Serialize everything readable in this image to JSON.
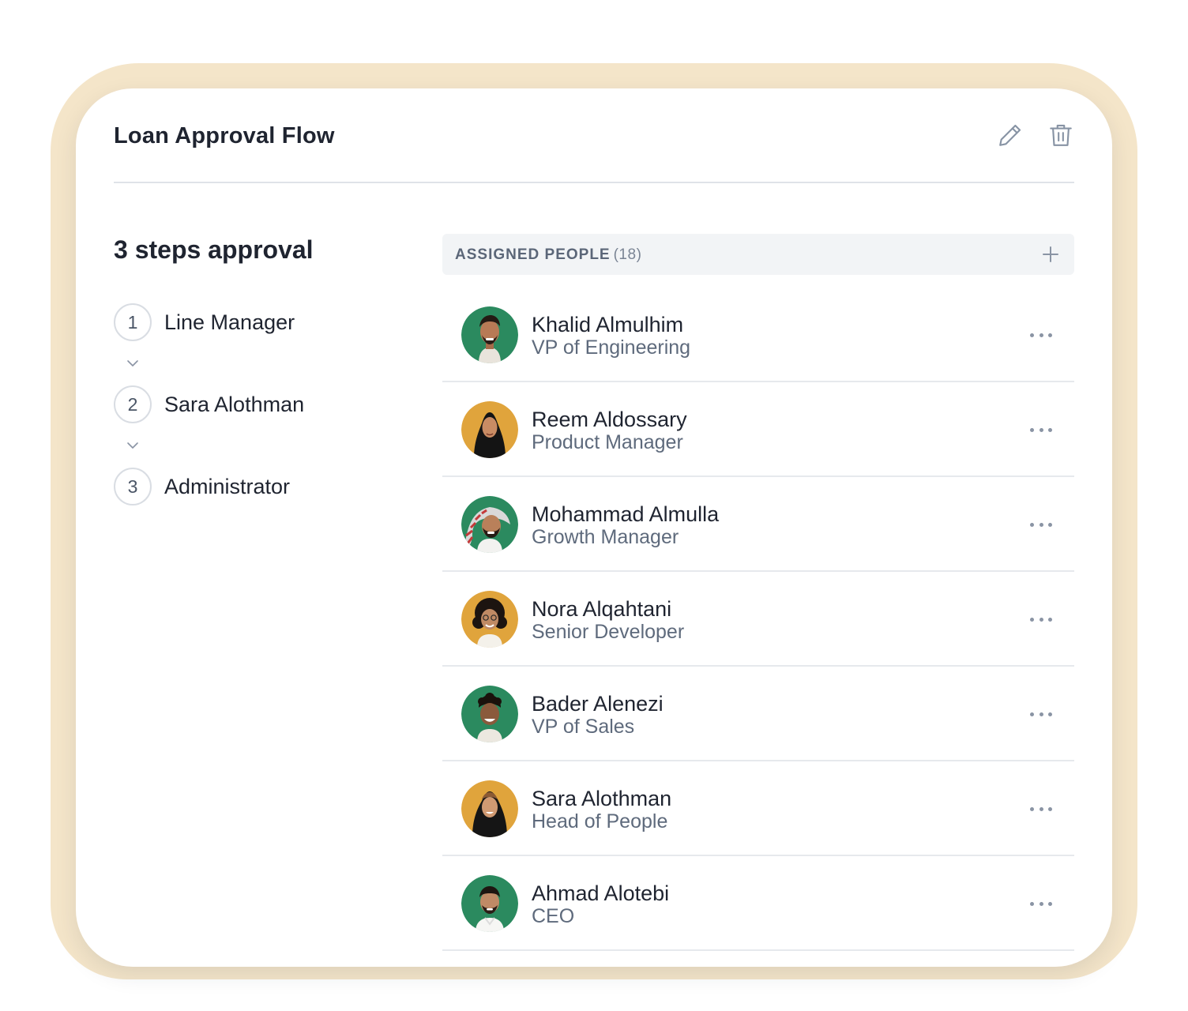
{
  "card": {
    "title": "Loan Approval Flow",
    "edit_icon": "pencil-icon",
    "delete_icon": "trash-icon"
  },
  "steps": {
    "title": "3 steps approval",
    "items": [
      {
        "number": "1",
        "label": "Line Manager"
      },
      {
        "number": "2",
        "label": "Sara Alothman"
      },
      {
        "number": "3",
        "label": "Administrator"
      }
    ]
  },
  "assigned": {
    "label": "ASSIGNED PEOPLE",
    "count": "(18)",
    "add_icon": "plus-icon"
  },
  "people": [
    {
      "name": "Khalid Almulhim",
      "role": "VP of Engineering",
      "avatar_bg": "#2b8a5f"
    },
    {
      "name": "Reem Aldossary",
      "role": "Product Manager",
      "avatar_bg": "#e0a43c"
    },
    {
      "name": "Mohammad Almulla",
      "role": "Growth Manager",
      "avatar_bg": "#2b8a5f"
    },
    {
      "name": "Nora Alqahtani",
      "role": "Senior Developer",
      "avatar_bg": "#e0a43c"
    },
    {
      "name": "Bader Alenezi",
      "role": "VP of Sales",
      "avatar_bg": "#2b8a5f"
    },
    {
      "name": "Sara Alothman",
      "role": "Head of People",
      "avatar_bg": "#e0a43c"
    },
    {
      "name": "Ahmad Alotebi",
      "role": "CEO",
      "avatar_bg": "#2b8a5f"
    }
  ],
  "colors": {
    "frame": "#f4e5c9",
    "green": "#2b8a5f",
    "amber": "#e0a43c",
    "muted_text": "#5e6a7c"
  }
}
